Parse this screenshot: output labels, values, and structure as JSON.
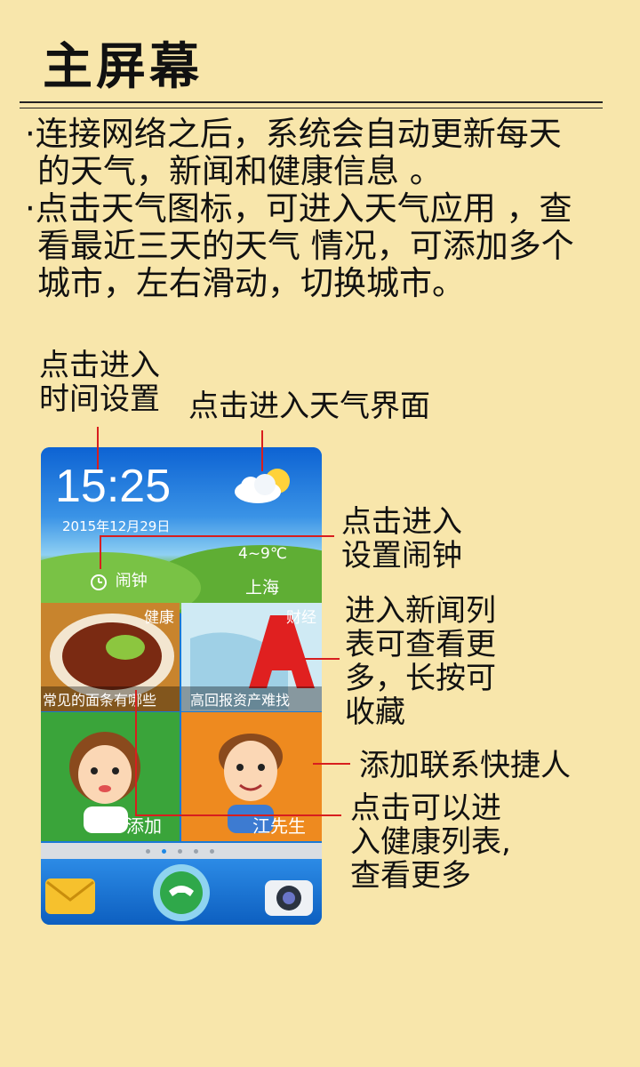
{
  "header": {
    "title": "主屏幕"
  },
  "description": {
    "line1": "·连接网络之后，系统会自动更新每天",
    "line2": "的天气，新闻和健康信息 。",
    "line3": "·点击天气图标，可进入天气应用 ，查",
    "line4": "看最近三天的天气 情况，可添加多个",
    "line5": "城市，左右滑动，切换城市。"
  },
  "annotations": {
    "time_setting_1": "点击进入",
    "time_setting_2": "时间设置",
    "weather": "点击进入天气界面",
    "alarm_1": "点击进入",
    "alarm_2": "设置闹钟",
    "news_1": "进入新闻列",
    "news_2": "表可查看更",
    "news_3": "多，长按可",
    "news_4": "收藏",
    "contact": "添加联系快捷人",
    "health_1": "点击可以进",
    "health_2": "入健康列表,",
    "health_3": "查看更多"
  },
  "phone": {
    "time": "15:25",
    "date": "2015年12月29日",
    "alarm_label": "闹钟",
    "temperature": "4~9℃",
    "city": "上海",
    "tiles": {
      "health_tag": "健康",
      "health_caption": "常见的面条有哪些",
      "finance_tag": "财经",
      "finance_caption": "高回报资产难找",
      "contact_add": "添加",
      "contact_name": "江先生"
    },
    "icons": [
      "alarm-clock-icon",
      "sun-cloud-icon",
      "mail-icon",
      "phone-icon",
      "camera-icon"
    ]
  },
  "colors": {
    "background": "#f8e6ab",
    "annotation_line": "#d81e1e",
    "weather_sky": "#1c74dc"
  }
}
